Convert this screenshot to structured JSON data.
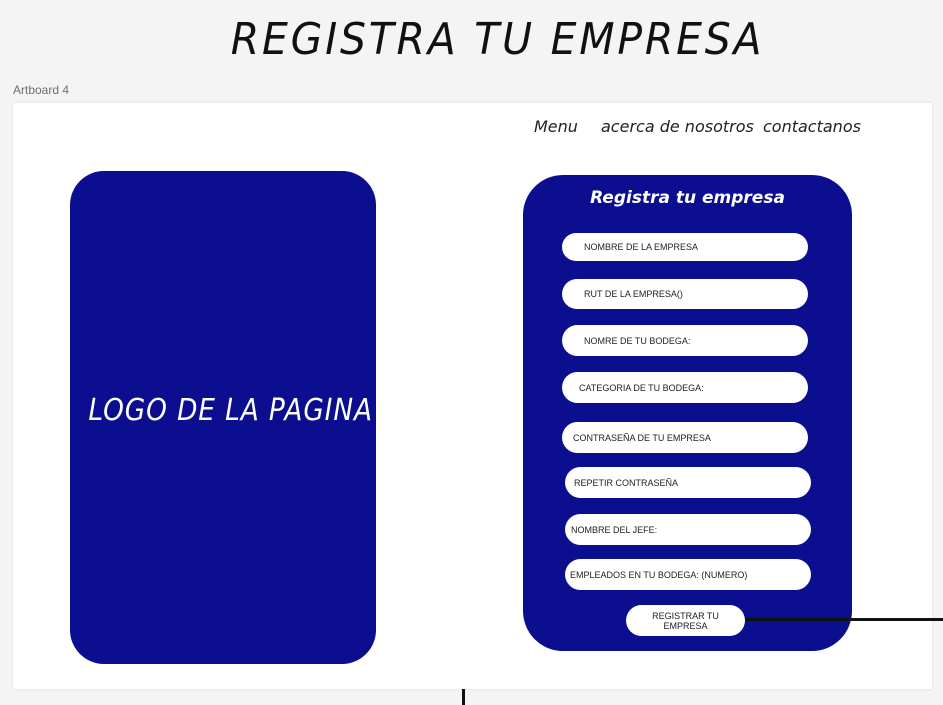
{
  "page": {
    "title": "REGISTRA TU EMPRESA"
  },
  "artboard": {
    "label": "Artboard 4"
  },
  "nav": {
    "menu": "Menu",
    "about": "acerca de nosotros",
    "contact": "contactanos"
  },
  "logo": {
    "text": "LOGO DE LA PAGINA"
  },
  "form": {
    "title": "Registra tu empresa",
    "fields": {
      "company_name": "NOMBRE DE LA EMPRESA",
      "company_rut": "RUT DE LA EMPRESA()",
      "warehouse_name": "NOMRE DE TU BODEGA:",
      "warehouse_category": "CATEGORIA DE TU BODEGA:",
      "password": "CONTRASEÑA DE TU EMPRESA",
      "password_repeat": "REPETIR CONTRASEÑA",
      "boss_name": "NOMBRE DEL JEFE:",
      "employees": "EMPLEADOS EN TU BODEGA: (NUMERO)"
    },
    "submit_label": "REGISTRAR TU EMPRESA"
  },
  "colors": {
    "panel": "#0a0e8f",
    "background": "#f4f4f4",
    "artboard": "#ffffff"
  }
}
